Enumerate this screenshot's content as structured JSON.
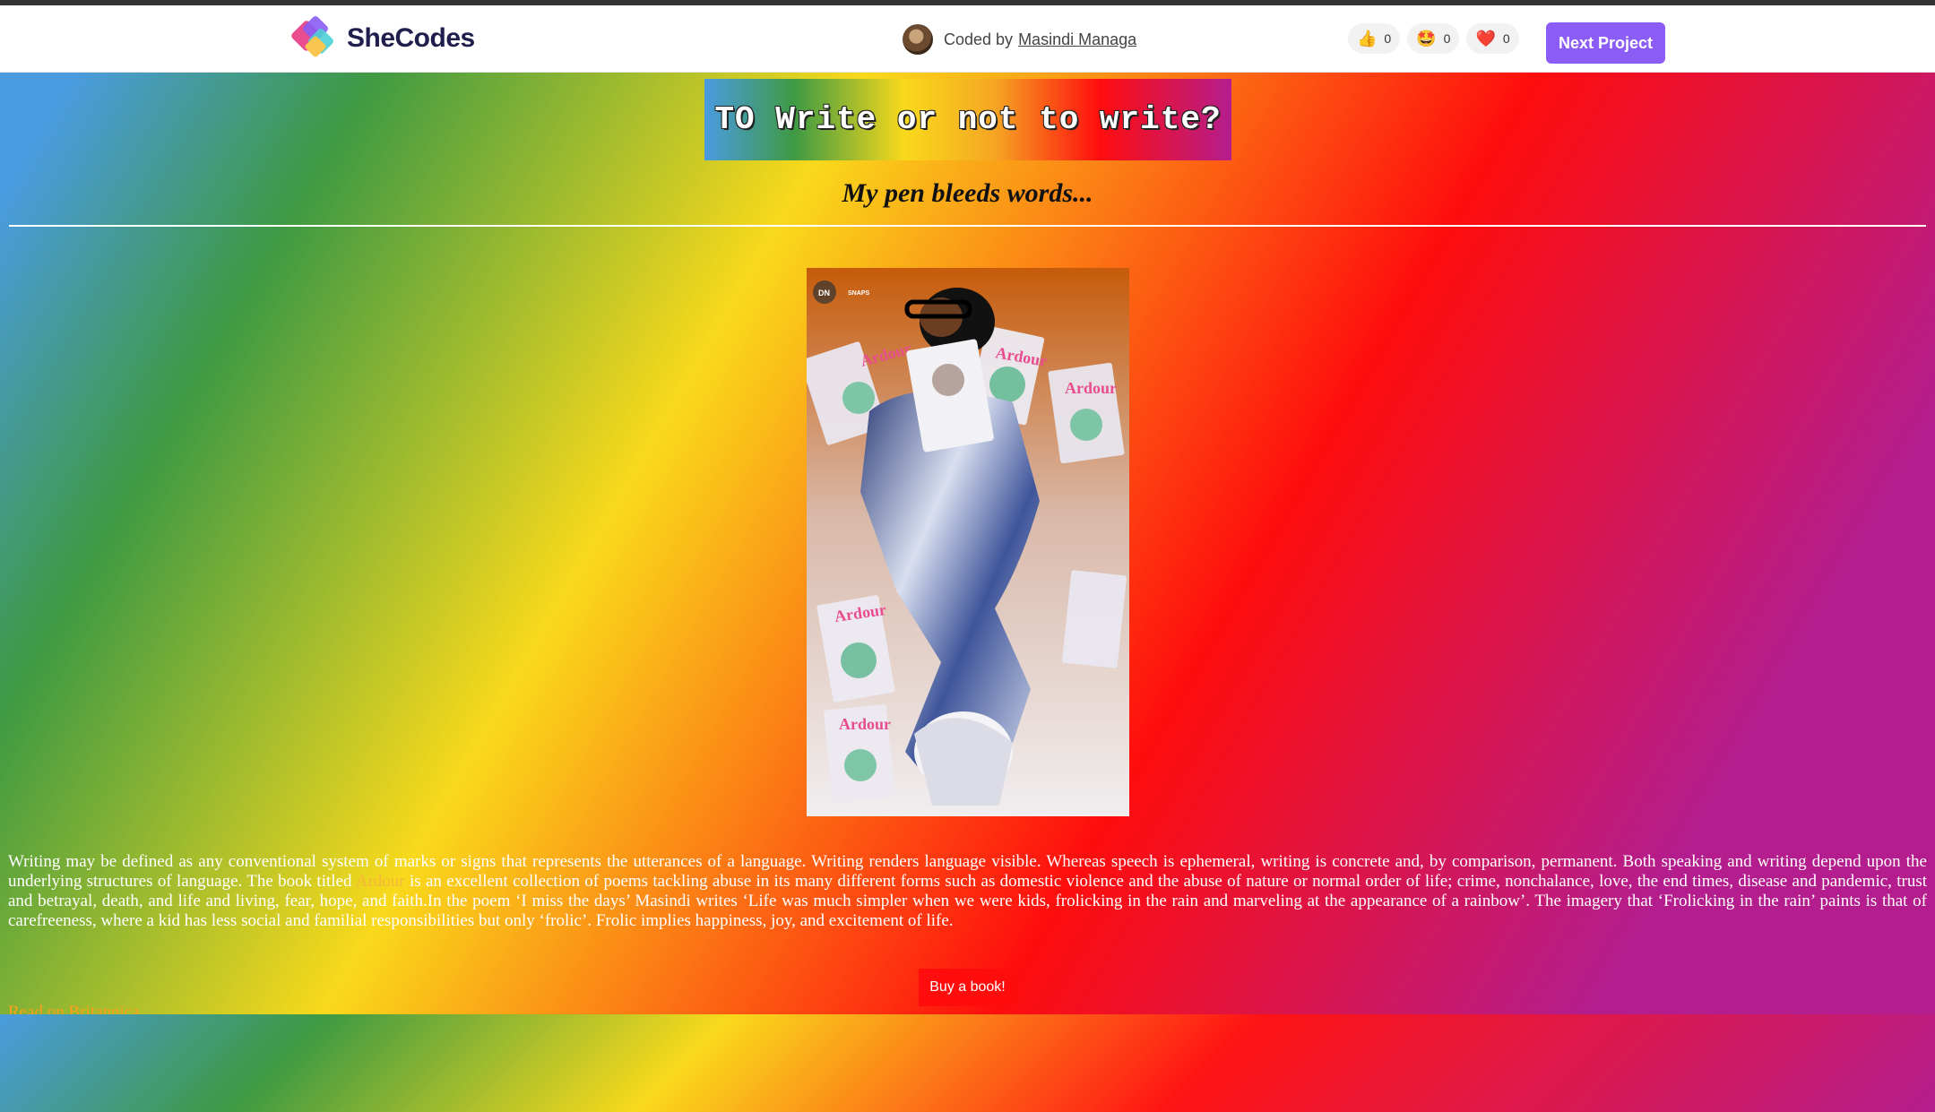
{
  "navbar": {
    "brand": "SheCodes",
    "author_prefix": "Coded by",
    "author_name": "Masindi Managa",
    "reactions": [
      {
        "icon": "thumbs-up-icon",
        "glyph": "👍",
        "count": "0"
      },
      {
        "icon": "star-struck-icon",
        "glyph": "🤩",
        "count": "0"
      },
      {
        "icon": "heart-icon",
        "glyph": "❤️",
        "count": "0"
      }
    ],
    "next_label": "Next Project",
    "accent": "#8b5cf6"
  },
  "page": {
    "title": "TO Write or not to write?",
    "subtitle": "My pen bleeds words...",
    "photo_watermark_left": "DN",
    "photo_watermark_right": "SNAPS",
    "book_cover_text": "Ardour",
    "paragraph_part1": "Writing may be defined as any conventional system of marks or signs that represents the utterances of a language. Writing renders language visible. Whereas speech is ephemeral, writing is concrete and, by comparison, permanent. Both speaking and writing depend upon the underlying structures of language. The book titled ",
    "book_title": "Ardour",
    "paragraph_part2": " is an excellent collection of poems tackling abuse in its many different forms such as domestic violence and the abuse of nature or normal order of life; crime, nonchalance, love, the end times, disease and pandemic, trust and betrayal, death, and life and living, fear, hope, and faith.In the poem ‘I miss the days’ Masindi writes ‘Life was much simpler when we were kids, frolicking in the rain and marveling at the appearance of a rainbow’. The imagery that ‘Frolicking in the rain’ paints is that of carefreeness, where a kid has less social and familial responsibilities but only ‘frolic’. Frolic implies happiness, joy, and excitement of life.",
    "read_more": "Read on Britannica",
    "buy_label": "Buy a book!",
    "colors": {
      "blue": "#4a9be0",
      "green": "#3e9a43",
      "yellow": "#f9d91b",
      "red": "#ff0d0d",
      "purple": "#b41d8d"
    }
  }
}
